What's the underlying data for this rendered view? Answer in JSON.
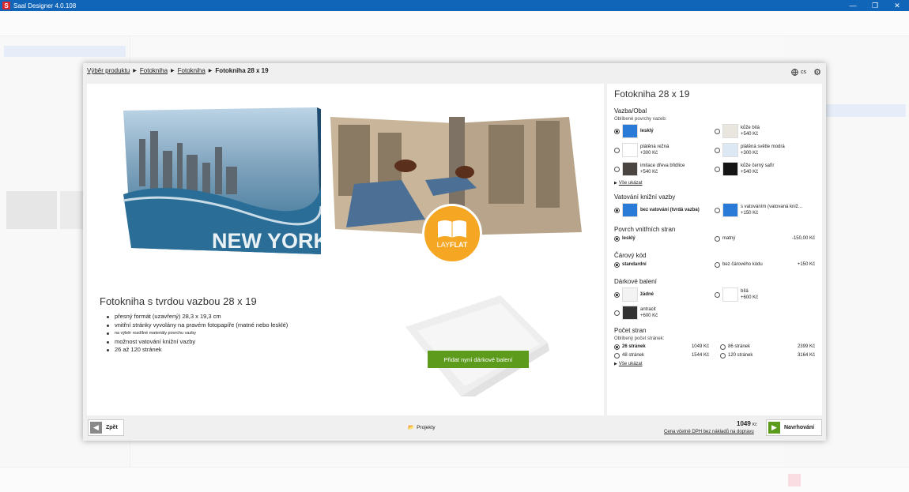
{
  "app": {
    "title": "Saal Designer 4.0.108",
    "logo_letter": "S"
  },
  "window_controls": {
    "minimize": "—",
    "maximize": "❐",
    "close": "✕"
  },
  "breadcrumb": {
    "items": [
      "Výběr produktu",
      "Fotokniha",
      "Fotokniha"
    ],
    "current": "Fotokniha 28 x 19",
    "separator": "▶"
  },
  "language": {
    "code": "cs"
  },
  "product": {
    "title": "Fotokniha s tvrdou vazbou 28 x 19",
    "bullets": [
      {
        "text": "přesný formát (uzavřený) 28,3 x 19,3 cm",
        "size": "big"
      },
      {
        "text": "vnitřní stránky vyvolány na pravém fotopapíře (matné nebo lesklé)",
        "size": "big"
      },
      {
        "text": "na výběr rozdílné materiály povrchu vazby",
        "size": "small"
      },
      {
        "text": "možnost vatování knižní vazby",
        "size": "big"
      },
      {
        "text": "26 až 120 stránek",
        "size": "big"
      }
    ],
    "cover_text": "NEW YORK",
    "layflat_badge": {
      "prefix": "LAY",
      "suffix": "FLAT"
    },
    "gift_button": "Přidat nyní dárkové balení"
  },
  "config": {
    "title": "Fotokniha 28 x 19",
    "binding": {
      "heading": "Vazba/Obal",
      "subheading": "Oblíbené povrchy vazeb:",
      "options": [
        {
          "name": "lesklý",
          "price": "",
          "selected": true,
          "color": "#2a7ad8"
        },
        {
          "name": "kůže bílá",
          "price": "+540 Kč",
          "selected": false,
          "color": "#e9e6e0"
        },
        {
          "name": "plátěná režná",
          "price": "+300 Kč",
          "selected": false,
          "color": "#ffffff"
        },
        {
          "name": "plátěná světle modrá",
          "price": "+300 Kč",
          "selected": false,
          "color": "#dce9f5"
        },
        {
          "name": "imitace dřeva břidlice",
          "price": "+540 Kč",
          "selected": false,
          "color": "#4a4540"
        },
        {
          "name": "kůže černý safír",
          "price": "+540 Kč",
          "selected": false,
          "color": "#151515"
        }
      ],
      "show_all": "Vše ukázat"
    },
    "padding": {
      "heading": "Vatování knižní vazby",
      "options": [
        {
          "name": "bez vatování (tvrdá vazba)",
          "price": "",
          "selected": true
        },
        {
          "name": "s vatováním (vatovaná kniž…",
          "price": "+150 Kč",
          "selected": false
        }
      ]
    },
    "surface": {
      "heading": "Povrch vnitřních stran",
      "options": [
        {
          "name": "lesklý",
          "price": "",
          "selected": true
        },
        {
          "name": "matný",
          "price": "-150,00 Kč",
          "selected": false
        }
      ]
    },
    "barcode": {
      "heading": "Čárový kód",
      "options": [
        {
          "name": "standardní",
          "price": "",
          "selected": true
        },
        {
          "name": "bez čárového kódu",
          "price": "+150 Kč",
          "selected": false
        }
      ]
    },
    "gift": {
      "heading": "Dárkové balení",
      "options": [
        {
          "name": "žádné",
          "price": "",
          "selected": true
        },
        {
          "name": "bílá",
          "price": "+600 Kč",
          "selected": false
        },
        {
          "name": "antracit",
          "price": "+600 Kč",
          "selected": false
        }
      ]
    },
    "pages": {
      "heading": "Počet stran",
      "subheading": "Oblíbený počet stránek:",
      "options": [
        {
          "name": "26 stránek",
          "price": "1049 Kč",
          "selected": true
        },
        {
          "name": "86 stránek",
          "price": "2399 Kč",
          "selected": false
        },
        {
          "name": "48 stránek",
          "price": "1544 Kč",
          "selected": false
        },
        {
          "name": "120 stránek",
          "price": "3164 Kč",
          "selected": false
        }
      ],
      "show_all": "Vše ukázat"
    }
  },
  "footer": {
    "back": "Zpět",
    "projects": "Projekty",
    "total": "1049",
    "currency": "Kč",
    "vat_note": "Cena včetně DPH bez nákladů na dopravu",
    "next": "Navrhování"
  }
}
